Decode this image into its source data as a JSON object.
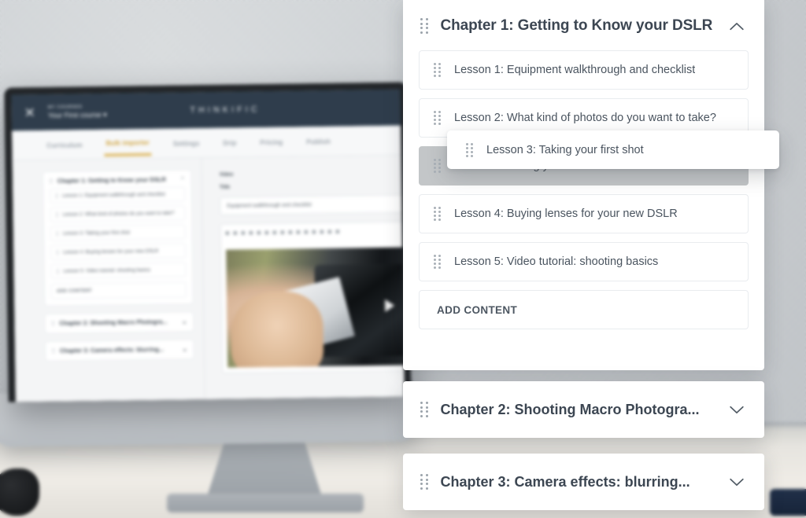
{
  "background_app": {
    "topbar": {
      "close_icon": "close-icon",
      "breadcrumb_small": "MY COURSES",
      "breadcrumb_main": "Your First course",
      "breadcrumb_caret": "▾",
      "brand": "THINKIFIC"
    },
    "tabs": [
      {
        "label": "Curriculum",
        "active": false
      },
      {
        "label": "Bulk importer",
        "active": true
      },
      {
        "label": "Settings",
        "active": false
      },
      {
        "label": "Drip",
        "active": false
      },
      {
        "label": "Pricing",
        "active": false
      },
      {
        "label": "Publish",
        "active": false
      }
    ],
    "sidebar": {
      "chapter1_title": "Chapter 1: Getting to Know your DSLR",
      "lessons": [
        "Lesson 1: Equipment walkthrough and checklist",
        "Lesson 2: What kind of photos do you want to take?",
        "Lesson 3: Taking your first shot",
        "Lesson 4: Buying lenses for your new DSLR",
        "Lesson 5: Video tutorial: shooting basics"
      ],
      "add_content": "ADD CONTENT",
      "chapter2_title": "Chapter 2:  Shooting Macro Photogra...",
      "chapter3_title": "Chapter 3: Camera effects: blurring..."
    },
    "detail": {
      "type_label": "Video",
      "title_label": "Title",
      "title_value": "Equipment walkthrough and checklist"
    }
  },
  "overlay": {
    "chapter1": {
      "title": "Chapter 1: Getting to Know your DSLR",
      "collapse_icon": "chevron-up-icon",
      "lessons": [
        {
          "label": "Lesson 1: Equipment walkthrough and checklist",
          "state": "normal"
        },
        {
          "label": "Lesson 2: What kind of photos do you want to take?",
          "state": "normal"
        },
        {
          "label": "Lesson 3: Taking your first shot",
          "state": "placeholder"
        },
        {
          "label": "Lesson 4: Buying lenses for your new DSLR",
          "state": "normal"
        },
        {
          "label": "Lesson 5: Video tutorial: shooting basics",
          "state": "normal"
        }
      ],
      "add_content_label": "ADD CONTENT"
    },
    "dragging_card": {
      "label": "Lesson 3: Taking your first shot",
      "handle_icon": "drag-handle-icon"
    },
    "chapter2": {
      "title": "Chapter 2:  Shooting Macro Photogra...",
      "expand_icon": "chevron-down-icon"
    },
    "chapter3": {
      "title": "Chapter 3: Camera effects: blurring...",
      "expand_icon": "chevron-down-icon"
    }
  },
  "colors": {
    "panel_bg": "#ffffff",
    "title_text": "#3c4652",
    "lesson_text": "#4a545f",
    "placeholder_bg": "#c3c6c8",
    "border": "#e9ecef",
    "topbar_navy": "#2e3d4d",
    "accent_gold": "#dcae44"
  }
}
